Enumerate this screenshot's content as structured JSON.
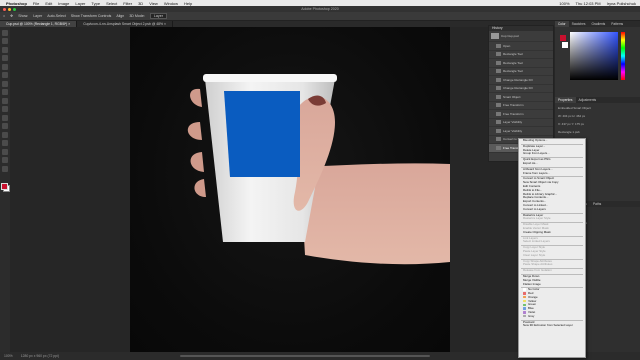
{
  "macbar": {
    "apple": "",
    "app": "Photoshop",
    "menus": [
      "File",
      "Edit",
      "Image",
      "Layer",
      "Type",
      "Select",
      "Filter",
      "3D",
      "View",
      "Window",
      "Help"
    ],
    "status": [
      "100%",
      "Thu 12:03 PM",
      "Iryna Polishchuk"
    ]
  },
  "titlebar": {
    "title": "Adobe Photoshop 2020"
  },
  "options": {
    "home": "⌂",
    "items": [
      "Show:",
      "Layer",
      "Auto-Select",
      "Show Transform Controls",
      "Align",
      "3D Mode:"
    ],
    "field_value": "Layer"
  },
  "tabs": [
    {
      "label": "Cup.psd @ 100% (Rectangle 1, RGB/8*) ×",
      "active": true
    },
    {
      "label": "Cup/ucon-4-nn-Unsplash Smart Object 2.psb @ 48% ×",
      "active": false
    }
  ],
  "status": {
    "zoom": "100%",
    "doc": "1280 px x 960 px (72 ppi)"
  },
  "colors": {
    "foreground": "#c8102e",
    "background": "#ffffff",
    "accent": "#0a5cc0"
  },
  "history": {
    "title": "History",
    "snapshot": "Cup Cup.psd",
    "steps": [
      "Open",
      "Rectangle Tool",
      "Rectangle Tool",
      "Rectangle Tool",
      "Change Rectangle Fill",
      "Change Rectangle Fill",
      "Smart Object",
      "Free Transform",
      "Free Transform",
      "Layer Visibility",
      "Layer Visibility",
      "Convert to Smart Object",
      "Free Transform"
    ],
    "active_index": 12
  },
  "right_panel": {
    "tabs": [
      "Color",
      "Swatches",
      "Gradients",
      "Patterns"
    ],
    "props_tabs": [
      "Properties",
      "Adjustments"
    ],
    "props_type": "Embedded Smart Object",
    "props_rows": [
      "W: 404 px   H: 462 px",
      "X: 437 px   Y: 175 px",
      "Rectangle 1.psb"
    ],
    "layers_tabs": [
      "Layers",
      "Channels",
      "Paths"
    ],
    "layers_rows": [
      "Kind",
      "Normal   Opacity: 100%",
      "Lock:   Fill: 100%",
      "Rectangle 1",
      "Background"
    ]
  },
  "context_menu": {
    "items": [
      {
        "label": "Blending Options...",
        "enabled": true
      },
      {
        "sep": true
      },
      {
        "label": "Duplicate Layer...",
        "enabled": true
      },
      {
        "label": "Delete Layer",
        "enabled": true
      },
      {
        "label": "Group from Layers...",
        "enabled": true
      },
      {
        "sep": true
      },
      {
        "label": "Quick Export as PNG",
        "enabled": true
      },
      {
        "label": "Export As...",
        "enabled": true
      },
      {
        "sep": true
      },
      {
        "label": "Artboard from Layers...",
        "enabled": true
      },
      {
        "label": "Frame from Layers...",
        "enabled": true
      },
      {
        "sep": true
      },
      {
        "label": "Convert to Smart Object",
        "enabled": true
      },
      {
        "label": "New Smart Object via Copy",
        "enabled": true
      },
      {
        "label": "Edit Contents",
        "enabled": true
      },
      {
        "label": "Relink to File...",
        "enabled": true
      },
      {
        "label": "Relink to Library Graphic...",
        "enabled": true
      },
      {
        "label": "Replace Contents...",
        "enabled": true
      },
      {
        "label": "Export Contents...",
        "enabled": true
      },
      {
        "label": "Convert to Linked...",
        "enabled": true
      },
      {
        "label": "Convert to Layers",
        "enabled": true
      },
      {
        "sep": true
      },
      {
        "label": "Rasterize Layer",
        "enabled": true
      },
      {
        "label": "Rasterize Layer Style",
        "enabled": false
      },
      {
        "sep": true
      },
      {
        "label": "Disable Layer Mask",
        "enabled": false
      },
      {
        "label": "Enable Vector Mask",
        "enabled": false
      },
      {
        "label": "Create Clipping Mask",
        "enabled": true
      },
      {
        "sep": true
      },
      {
        "label": "Link Layers",
        "enabled": false
      },
      {
        "label": "Select Linked Layers",
        "enabled": false
      },
      {
        "sep": true
      },
      {
        "label": "Copy Layer Style",
        "enabled": false
      },
      {
        "label": "Paste Layer Style",
        "enabled": false
      },
      {
        "label": "Clear Layer Style",
        "enabled": false
      },
      {
        "sep": true
      },
      {
        "label": "Copy Shape Attributes",
        "enabled": false
      },
      {
        "label": "Paste Shape Attributes",
        "enabled": false
      },
      {
        "sep": true
      },
      {
        "label": "Release from Isolation",
        "enabled": false
      },
      {
        "sep": true
      },
      {
        "label": "Merge Down",
        "enabled": true
      },
      {
        "label": "Merge Visible",
        "enabled": true
      },
      {
        "label": "Flatten Image",
        "enabled": true
      },
      {
        "sep": true
      },
      {
        "label": "No Color",
        "color": "#ffffff",
        "enabled": true
      },
      {
        "label": "Red",
        "color": "#e86a6a",
        "enabled": true
      },
      {
        "label": "Orange",
        "color": "#f0a050",
        "enabled": true
      },
      {
        "label": "Yellow",
        "color": "#f0e060",
        "enabled": true
      },
      {
        "label": "Green",
        "color": "#70c070",
        "enabled": true
      },
      {
        "label": "Blue",
        "color": "#70a0e0",
        "enabled": true
      },
      {
        "label": "Violet",
        "color": "#b080d0",
        "enabled": true
      },
      {
        "label": "Gray",
        "color": "#aaaaaa",
        "enabled": true
      },
      {
        "sep": true
      },
      {
        "label": "Postcard",
        "enabled": true
      },
      {
        "label": "New 3D Extrusion from Selected Layer",
        "enabled": true
      }
    ]
  }
}
